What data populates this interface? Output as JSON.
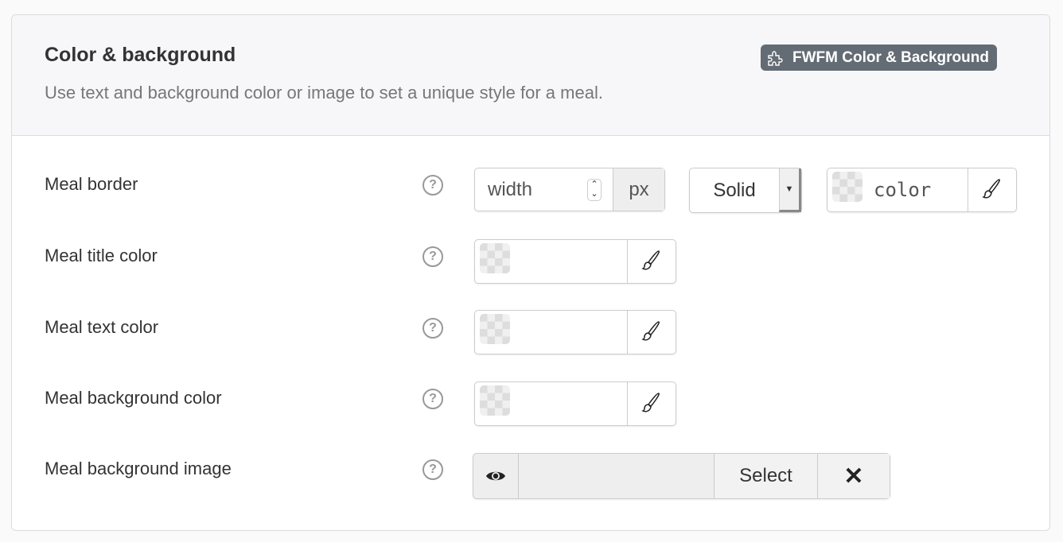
{
  "header": {
    "title": "Color & background",
    "description": "Use text and background color or image to set a unique style for a meal.",
    "badge": "FWFM Color & Background",
    "badge_icon": "puzzle-icon"
  },
  "rows": [
    {
      "label": "Meal border",
      "help": "?",
      "width_placeholder": "width",
      "unit": "px",
      "style_value": "Solid",
      "color_placeholder": "color"
    },
    {
      "label": "Meal title color",
      "help": "?"
    },
    {
      "label": "Meal text color",
      "help": "?"
    },
    {
      "label": "Meal background color",
      "help": "?"
    },
    {
      "label": "Meal background image",
      "help": "?",
      "select_label": "Select",
      "clear_label": "✕"
    }
  ],
  "colors": {
    "badge_bg": "#636c74",
    "header_bg": "#f7f7f9"
  }
}
